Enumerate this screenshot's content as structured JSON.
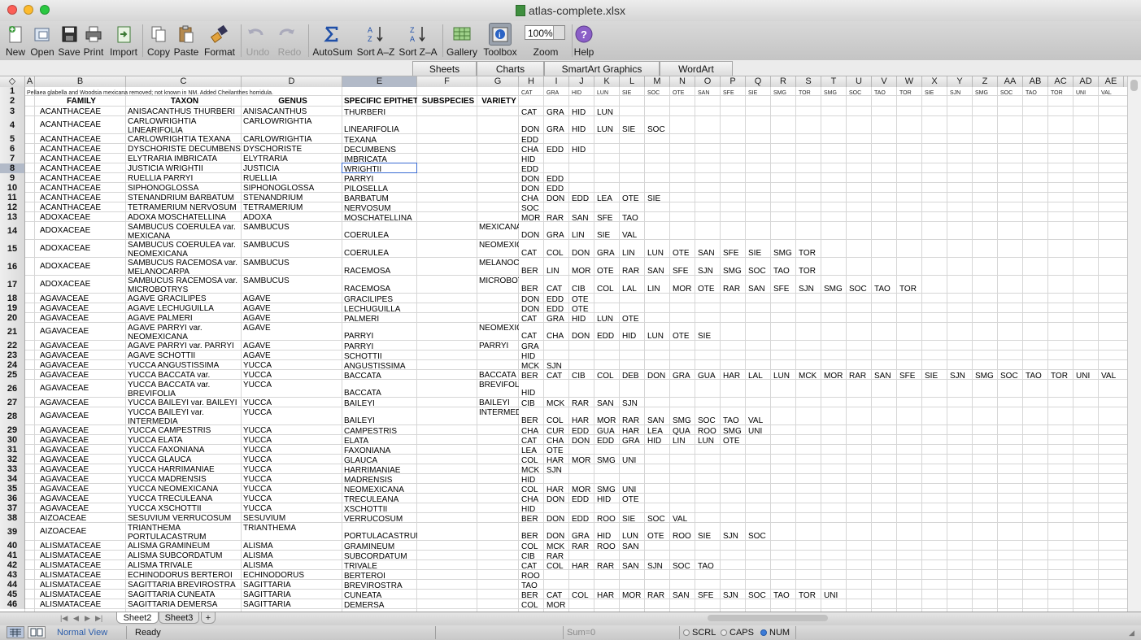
{
  "window": {
    "title": "atlas-complete.xlsx"
  },
  "toolbar": {
    "new": "New",
    "open": "Open",
    "save": "Save",
    "print": "Print",
    "import": "Import",
    "copy": "Copy",
    "paste": "Paste",
    "format": "Format",
    "undo": "Undo",
    "redo": "Redo",
    "autosum": "AutoSum",
    "sort_az": "Sort A–Z",
    "sort_za": "Sort Z–A",
    "gallery": "Gallery",
    "toolbox": "Toolbox",
    "zoom": "Zoom",
    "zoom_value": "100%",
    "help": "Help"
  },
  "ribbon": {
    "tabs": [
      "Sheets",
      "Charts",
      "SmartArt Graphics",
      "WordArt"
    ]
  },
  "columns": [
    "◇",
    "A",
    "B",
    "C",
    "D",
    "E",
    "F",
    "G",
    "H",
    "I",
    "J",
    "K",
    "L",
    "M",
    "N",
    "O",
    "P",
    "Q",
    "R",
    "S",
    "T",
    "U",
    "V",
    "W",
    "X",
    "Y",
    "Z",
    "AA",
    "AB",
    "AC",
    "AD",
    "AE"
  ],
  "selected_column": "E",
  "selected_row": "8",
  "row1_note": "Pellaea glabella and Woodsia mexicana removed; not known in NM. Added Cheilanthes horridula.",
  "row1_abbrevs": [
    "CAT",
    "GRA",
    "HID",
    "LUN",
    "SIE",
    "SOC",
    "OTE",
    "SAN",
    "SFE",
    "SIE",
    "SMG",
    "TOR",
    "SMG",
    "SOC",
    "TAO",
    "TOR",
    "SIE",
    "SJN",
    "SMG",
    "SOC",
    "TAO",
    "TOR",
    "UNI",
    "VAL"
  ],
  "headers": {
    "family": "FAMILY",
    "taxon": "TAXON",
    "genus": "GENUS",
    "epithet": "SPECIFIC EPITHET",
    "subspecies": "SUBSPECIES",
    "variety": "VARIETY"
  },
  "rows": [
    {
      "n": "3",
      "family": "ACANTHACEAE",
      "taxon": [
        "ANISACANTHUS THURBERI"
      ],
      "genus": "ANISACANTHUS",
      "epithet": "THURBERI",
      "variety": "",
      "codes": [
        "CAT",
        "GRA",
        "HID",
        "LUN"
      ]
    },
    {
      "n": "4",
      "family": "ACANTHACEAE",
      "taxon": [
        "CARLOWRIGHTIA",
        "LINEARIFOLIA"
      ],
      "genus": "CARLOWRIGHTIA",
      "epithet": "LINEARIFOLIA",
      "variety": "",
      "codes": [
        "DON",
        "GRA",
        "HID",
        "LUN",
        "SIE",
        "SOC"
      ]
    },
    {
      "n": "5",
      "family": "ACANTHACEAE",
      "taxon": [
        "CARLOWRIGHTIA TEXANA"
      ],
      "genus": "CARLOWRIGHTIA",
      "epithet": "TEXANA",
      "variety": "",
      "codes": [
        "EDD"
      ]
    },
    {
      "n": "6",
      "family": "ACANTHACEAE",
      "taxon": [
        "DYSCHORISTE DECUMBENS"
      ],
      "genus": "DYSCHORISTE",
      "epithet": "DECUMBENS",
      "variety": "",
      "codes": [
        "CHA",
        "EDD",
        "HID"
      ]
    },
    {
      "n": "7",
      "family": "ACANTHACEAE",
      "taxon": [
        "ELYTRARIA IMBRICATA"
      ],
      "genus": "ELYTRARIA",
      "epithet": "IMBRICATA",
      "variety": "",
      "codes": [
        "HID"
      ]
    },
    {
      "n": "8",
      "family": "ACANTHACEAE",
      "taxon": [
        "JUSTICIA WRIGHTII"
      ],
      "genus": "JUSTICIA",
      "epithet": "WRIGHTII",
      "variety": "",
      "codes": [
        "EDD"
      ]
    },
    {
      "n": "9",
      "family": "ACANTHACEAE",
      "taxon": [
        "RUELLIA PARRYI"
      ],
      "genus": "RUELLIA",
      "epithet": "PARRYI",
      "variety": "",
      "codes": [
        "DON",
        "EDD"
      ]
    },
    {
      "n": "10",
      "family": "ACANTHACEAE",
      "taxon": [
        "SIPHONOGLOSSA PILOSELLA"
      ],
      "genus": "SIPHONOGLOSSA",
      "epithet": "PILOSELLA",
      "variety": "",
      "codes": [
        "DON",
        "EDD"
      ]
    },
    {
      "n": "11",
      "family": "ACANTHACEAE",
      "taxon": [
        "STENANDRIUM BARBATUM"
      ],
      "genus": "STENANDRIUM",
      "epithet": "BARBATUM",
      "variety": "",
      "codes": [
        "CHA",
        "DON",
        "EDD",
        "LEA",
        "OTE",
        "SIE"
      ]
    },
    {
      "n": "12",
      "family": "ACANTHACEAE",
      "taxon": [
        "TETRAMERIUM NERVOSUM"
      ],
      "genus": "TETRAMERIUM",
      "epithet": "NERVOSUM",
      "variety": "",
      "codes": [
        "SOC"
      ]
    },
    {
      "n": "13",
      "family": "ADOXACEAE",
      "taxon": [
        "ADOXA MOSCHATELLINA"
      ],
      "genus": "ADOXA",
      "epithet": "MOSCHATELLINA",
      "variety": "",
      "codes": [
        "MOR",
        "RAR",
        "SAN",
        "SFE",
        "TAO"
      ]
    },
    {
      "n": "14",
      "family": "ADOXACEAE",
      "taxon": [
        "SAMBUCUS COERULEA var.",
        "MEXICANA"
      ],
      "genus": "SAMBUCUS",
      "epithet": "COERULEA",
      "variety": "MEXICANA",
      "codes": [
        "DON",
        "GRA",
        "LIN",
        "SIE",
        "VAL"
      ]
    },
    {
      "n": "15",
      "family": "ADOXACEAE",
      "taxon": [
        "SAMBUCUS COERULEA var.",
        "NEOMEXICANA"
      ],
      "genus": "SAMBUCUS",
      "epithet": "COERULEA",
      "variety": "NEOMEXICANA",
      "codes": [
        "CAT",
        "COL",
        "DON",
        "GRA",
        "LIN",
        "LUN",
        "OTE",
        "SAN",
        "SFE",
        "SIE",
        "SMG",
        "TOR"
      ]
    },
    {
      "n": "16",
      "family": "ADOXACEAE",
      "taxon": [
        "SAMBUCUS RACEMOSA var.",
        "MELANOCARPA"
      ],
      "genus": "SAMBUCUS",
      "epithet": "RACEMOSA",
      "variety": "MELANOCARPA",
      "codes": [
        "BER",
        "LIN",
        "MOR",
        "OTE",
        "RAR",
        "SAN",
        "SFE",
        "SJN",
        "SMG",
        "SOC",
        "TAO",
        "TOR"
      ]
    },
    {
      "n": "17",
      "family": "ADOXACEAE",
      "taxon": [
        "SAMBUCUS RACEMOSA var.",
        "MICROBOTRYS"
      ],
      "genus": "SAMBUCUS",
      "epithet": "RACEMOSA",
      "variety": "MICROBOTRYS",
      "codes": [
        "BER",
        "CAT",
        "CIB",
        "COL",
        "LAL",
        "LIN",
        "MOR",
        "OTE",
        "RAR",
        "SAN",
        "SFE",
        "SJN",
        "SMG",
        "SOC",
        "TAO",
        "TOR"
      ]
    },
    {
      "n": "18",
      "family": "AGAVACEAE",
      "taxon": [
        "AGAVE GRACILIPES"
      ],
      "genus": "AGAVE",
      "epithet": "GRACILIPES",
      "variety": "",
      "codes": [
        "DON",
        "EDD",
        "OTE"
      ]
    },
    {
      "n": "19",
      "family": "AGAVACEAE",
      "taxon": [
        "AGAVE LECHUGUILLA"
      ],
      "genus": "AGAVE",
      "epithet": "LECHUGUILLA",
      "variety": "",
      "codes": [
        "DON",
        "EDD",
        "OTE"
      ]
    },
    {
      "n": "20",
      "family": "AGAVACEAE",
      "taxon": [
        "AGAVE PALMERI"
      ],
      "genus": "AGAVE",
      "epithet": "PALMERI",
      "variety": "",
      "codes": [
        "CAT",
        "GRA",
        "HID",
        "LUN",
        "OTE"
      ]
    },
    {
      "n": "21",
      "family": "AGAVACEAE",
      "taxon": [
        "AGAVE PARRYI var.",
        "NEOMEXICANA"
      ],
      "genus": "AGAVE",
      "epithet": "PARRYI",
      "variety": "NEOMEXICANA",
      "codes": [
        "CAT",
        "CHA",
        "DON",
        "EDD",
        "HID",
        "LUN",
        "OTE",
        "SIE"
      ]
    },
    {
      "n": "22",
      "family": "AGAVACEAE",
      "taxon": [
        "AGAVE PARRYI var. PARRYI"
      ],
      "genus": "AGAVE",
      "epithet": "PARRYI",
      "variety": "PARRYI",
      "codes": [
        "GRA"
      ]
    },
    {
      "n": "23",
      "family": "AGAVACEAE",
      "taxon": [
        "AGAVE SCHOTTII"
      ],
      "genus": "AGAVE",
      "epithet": "SCHOTTII",
      "variety": "",
      "codes": [
        "HID"
      ]
    },
    {
      "n": "24",
      "family": "AGAVACEAE",
      "taxon": [
        "YUCCA ANGUSTISSIMA"
      ],
      "genus": "YUCCA",
      "epithet": "ANGUSTISSIMA",
      "variety": "",
      "codes": [
        "MCK",
        "SJN"
      ]
    },
    {
      "n": "25",
      "family": "AGAVACEAE",
      "taxon": [
        "YUCCA BACCATA var. BACCATA"
      ],
      "genus": "YUCCA",
      "epithet": "BACCATA",
      "variety": "BACCATA",
      "codes": [
        "BER",
        "CAT",
        "CIB",
        "COL",
        "DEB",
        "DON",
        "GRA",
        "GUA",
        "HAR",
        "LAL",
        "LUN",
        "MCK",
        "MOR",
        "RAR",
        "SAN",
        "SFE",
        "SIE",
        "SJN",
        "SMG",
        "SOC",
        "TAO",
        "TOR",
        "UNI",
        "VAL"
      ]
    },
    {
      "n": "26",
      "family": "AGAVACEAE",
      "taxon": [
        "YUCCA BACCATA var.",
        "BREVIFOLIA"
      ],
      "genus": "YUCCA",
      "epithet": "BACCATA",
      "variety": "BREVIFOLIA",
      "codes": [
        "HID"
      ]
    },
    {
      "n": "27",
      "family": "AGAVACEAE",
      "taxon": [
        "YUCCA BAILEYI var. BAILEYI"
      ],
      "genus": "YUCCA",
      "epithet": "BAILEYI",
      "variety": "BAILEYI",
      "codes": [
        "CIB",
        "MCK",
        "RAR",
        "SAN",
        "SJN"
      ]
    },
    {
      "n": "28",
      "family": "AGAVACEAE",
      "taxon": [
        "YUCCA BAILEYI var.",
        "INTERMEDIA"
      ],
      "genus": "YUCCA",
      "epithet": "BAILEYI",
      "variety": "INTERMEDIA",
      "codes": [
        "BER",
        "COL",
        "HAR",
        "MOR",
        "RAR",
        "SAN",
        "SMG",
        "SOC",
        "TAO",
        "VAL"
      ]
    },
    {
      "n": "29",
      "family": "AGAVACEAE",
      "taxon": [
        "YUCCA CAMPESTRIS"
      ],
      "genus": "YUCCA",
      "epithet": "CAMPESTRIS",
      "variety": "",
      "codes": [
        "CHA",
        "CUR",
        "EDD",
        "GUA",
        "HAR",
        "LEA",
        "QUA",
        "ROO",
        "SMG",
        "UNI"
      ]
    },
    {
      "n": "30",
      "family": "AGAVACEAE",
      "taxon": [
        "YUCCA ELATA"
      ],
      "genus": "YUCCA",
      "epithet": "ELATA",
      "variety": "",
      "codes": [
        "CAT",
        "CHA",
        "DON",
        "EDD",
        "GRA",
        "HID",
        "LIN",
        "LUN",
        "OTE"
      ]
    },
    {
      "n": "31",
      "family": "AGAVACEAE",
      "taxon": [
        "YUCCA FAXONIANA"
      ],
      "genus": "YUCCA",
      "epithet": "FAXONIANA",
      "variety": "",
      "codes": [
        "LEA",
        "OTE"
      ]
    },
    {
      "n": "32",
      "family": "AGAVACEAE",
      "taxon": [
        "YUCCA GLAUCA"
      ],
      "genus": "YUCCA",
      "epithet": "GLAUCA",
      "variety": "",
      "codes": [
        "COL",
        "HAR",
        "MOR",
        "SMG",
        "UNI"
      ]
    },
    {
      "n": "33",
      "family": "AGAVACEAE",
      "taxon": [
        "YUCCA HARRIMANIAE"
      ],
      "genus": "YUCCA",
      "epithet": "HARRIMANIAE",
      "variety": "",
      "codes": [
        "MCK",
        "SJN"
      ]
    },
    {
      "n": "34",
      "family": "AGAVACEAE",
      "taxon": [
        "YUCCA MADRENSIS"
      ],
      "genus": "YUCCA",
      "epithet": "MADRENSIS",
      "variety": "",
      "codes": [
        "HID"
      ]
    },
    {
      "n": "35",
      "family": "AGAVACEAE",
      "taxon": [
        "YUCCA NEOMEXICANA"
      ],
      "genus": "YUCCA",
      "epithet": "NEOMEXICANA",
      "variety": "",
      "codes": [
        "COL",
        "HAR",
        "MOR",
        "SMG",
        "UNI"
      ]
    },
    {
      "n": "36",
      "family": "AGAVACEAE",
      "taxon": [
        "YUCCA TRECULEANA"
      ],
      "genus": "YUCCA",
      "epithet": "TRECULEANA",
      "variety": "",
      "codes": [
        "CHA",
        "DON",
        "EDD",
        "HID",
        "OTE"
      ]
    },
    {
      "n": "37",
      "family": "AGAVACEAE",
      "taxon": [
        "YUCCA XSCHOTTII"
      ],
      "genus": "YUCCA",
      "epithet": "XSCHOTTII",
      "variety": "",
      "codes": [
        "HID"
      ]
    },
    {
      "n": "38",
      "family": "AIZOACEAE",
      "taxon": [
        "SESUVIUM VERRUCOSUM"
      ],
      "genus": "SESUVIUM",
      "epithet": "VERRUCOSUM",
      "variety": "",
      "codes": [
        "BER",
        "DON",
        "EDD",
        "ROO",
        "SIE",
        "SOC",
        "VAL"
      ]
    },
    {
      "n": "39",
      "family": "AIZOACEAE",
      "taxon": [
        "TRIANTHEMA",
        "PORTULACASTRUM"
      ],
      "genus": "TRIANTHEMA",
      "epithet": "PORTULACASTRUM",
      "variety": "",
      "codes": [
        "BER",
        "DON",
        "GRA",
        "HID",
        "LUN",
        "OTE",
        "ROO",
        "SIE",
        "SJN",
        "SOC"
      ]
    },
    {
      "n": "40",
      "family": "ALISMATACEAE",
      "taxon": [
        "ALISMA GRAMINEUM"
      ],
      "genus": "ALISMA",
      "epithet": "GRAMINEUM",
      "variety": "",
      "codes": [
        "COL",
        "MCK",
        "RAR",
        "ROO",
        "SAN"
      ]
    },
    {
      "n": "41",
      "family": "ALISMATACEAE",
      "taxon": [
        "ALISMA SUBCORDATUM"
      ],
      "genus": "ALISMA",
      "epithet": "SUBCORDATUM",
      "variety": "",
      "codes": [
        "CIB",
        "RAR"
      ]
    },
    {
      "n": "42",
      "family": "ALISMATACEAE",
      "taxon": [
        "ALISMA TRIVALE"
      ],
      "genus": "ALISMA",
      "epithet": "TRIVALE",
      "variety": "",
      "codes": [
        "CAT",
        "COL",
        "HAR",
        "RAR",
        "SAN",
        "SJN",
        "SOC",
        "TAO"
      ]
    },
    {
      "n": "43",
      "family": "ALISMATACEAE",
      "taxon": [
        "ECHINODORUS BERTEROI"
      ],
      "genus": "ECHINODORUS",
      "epithet": "BERTEROI",
      "variety": "",
      "codes": [
        "ROO"
      ]
    },
    {
      "n": "44",
      "family": "ALISMATACEAE",
      "taxon": [
        "SAGITTARIA BREVIROSTRA"
      ],
      "genus": "SAGITTARIA",
      "epithet": "BREVIROSTRA",
      "variety": "",
      "codes": [
        "TAO"
      ]
    },
    {
      "n": "45",
      "family": "ALISMATACEAE",
      "taxon": [
        "SAGITTARIA CUNEATA"
      ],
      "genus": "SAGITTARIA",
      "epithet": "CUNEATA",
      "variety": "",
      "codes": [
        "BER",
        "CAT",
        "COL",
        "HAR",
        "MOR",
        "RAR",
        "SAN",
        "SFE",
        "SJN",
        "SOC",
        "TAO",
        "TOR",
        "UNI"
      ]
    },
    {
      "n": "46",
      "family": "ALISMATACEAE",
      "taxon": [
        "SAGITTARIA DEMERSA"
      ],
      "genus": "SAGITTARIA",
      "epithet": "DEMERSA",
      "variety": "",
      "codes": [
        "COL",
        "MOR"
      ]
    }
  ],
  "sheet_tabs": [
    "Sheet2",
    "Sheet3"
  ],
  "status": {
    "view": "Normal View",
    "ready": "Ready",
    "sum": "Sum=0",
    "scrl": "SCRL",
    "caps": "CAPS",
    "num": "NUM"
  }
}
